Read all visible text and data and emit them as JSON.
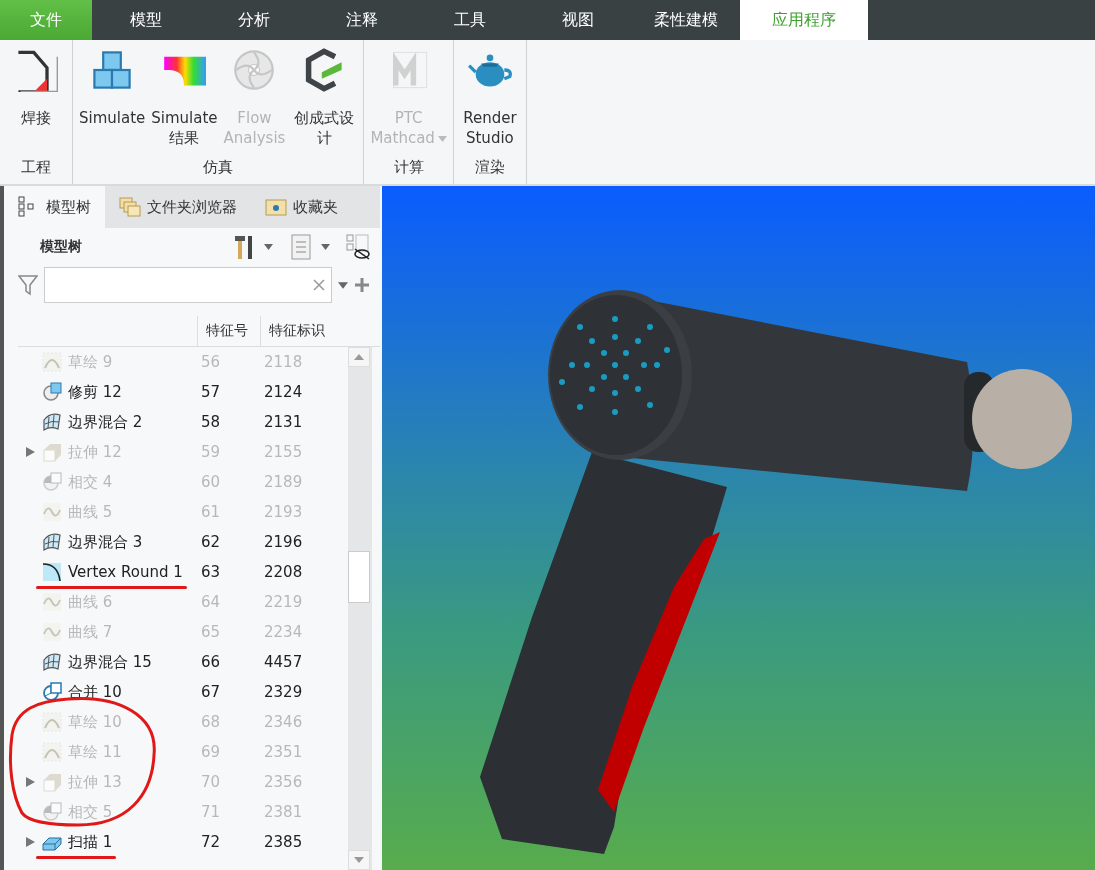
{
  "menu_tabs": [
    {
      "label": "文件",
      "kind": "file",
      "selected": false
    },
    {
      "label": "模型",
      "kind": "tab",
      "selected": false
    },
    {
      "label": "分析",
      "kind": "tab",
      "selected": false
    },
    {
      "label": "注释",
      "kind": "tab",
      "selected": false
    },
    {
      "label": "工具",
      "kind": "tab",
      "selected": false
    },
    {
      "label": "视图",
      "kind": "tab",
      "selected": false
    },
    {
      "label": "柔性建模",
      "kind": "tab",
      "selected": false
    },
    {
      "label": "应用程序",
      "kind": "tab",
      "selected": true
    }
  ],
  "ribbon": {
    "groups": [
      {
        "label": "工程",
        "buttons": [
          {
            "label": "焊接",
            "kind": "weld",
            "disabled": false,
            "dropdown": false
          }
        ]
      },
      {
        "label": "仿真",
        "buttons": [
          {
            "label": "Simulate",
            "kind": "simulate",
            "disabled": false,
            "dropdown": false
          },
          {
            "label": "Simulate\n结果",
            "kind": "results",
            "disabled": false,
            "dropdown": false
          },
          {
            "label": "Flow\nAnalysis",
            "kind": "flow",
            "disabled": true,
            "dropdown": false
          },
          {
            "label": "创成式设计",
            "kind": "generative",
            "disabled": false,
            "dropdown": false
          }
        ]
      },
      {
        "label": "计算",
        "buttons": [
          {
            "label": "PTC\nMathcad",
            "kind": "mathcad",
            "disabled": true,
            "dropdown": true
          }
        ]
      },
      {
        "label": "渲染",
        "buttons": [
          {
            "label": "Render\nStudio",
            "kind": "render",
            "disabled": false,
            "dropdown": false
          }
        ]
      }
    ]
  },
  "panel_tabs": [
    {
      "label": "模型树",
      "kind": "tree",
      "selected": true
    },
    {
      "label": "文件夹浏览器",
      "kind": "folders",
      "selected": false
    },
    {
      "label": "收藏夹",
      "kind": "favorites",
      "selected": false
    }
  ],
  "model_tree": {
    "title": "模型树",
    "columns": [
      "特征号",
      "特征标识"
    ],
    "sections": [
      {
        "circled": false,
        "rows": [
          {
            "name": "草绘 9",
            "number": "56",
            "id": "2118",
            "kind": "sketch",
            "suppressed": true,
            "expandable": false,
            "underlined": false
          },
          {
            "name": "修剪 12",
            "number": "57",
            "id": "2124",
            "kind": "trim",
            "suppressed": false,
            "expandable": false,
            "underlined": false
          },
          {
            "name": "边界混合 2",
            "number": "58",
            "id": "2131",
            "kind": "blend",
            "suppressed": false,
            "expandable": false,
            "underlined": false
          },
          {
            "name": "拉伸 12",
            "number": "59",
            "id": "2155",
            "kind": "extrude",
            "suppressed": true,
            "expandable": true,
            "underlined": false
          },
          {
            "name": "相交 4",
            "number": "60",
            "id": "2189",
            "kind": "intersect",
            "suppressed": true,
            "expandable": false,
            "underlined": false
          },
          {
            "name": "曲线 5",
            "number": "61",
            "id": "2193",
            "kind": "curve",
            "suppressed": true,
            "expandable": false,
            "underlined": false
          },
          {
            "name": "边界混合 3",
            "number": "62",
            "id": "2196",
            "kind": "blend",
            "suppressed": false,
            "expandable": false,
            "underlined": false
          },
          {
            "name": "Vertex Round 1",
            "number": "63",
            "id": "2208",
            "kind": "round",
            "suppressed": false,
            "expandable": false,
            "underlined": true
          },
          {
            "name": "曲线 6",
            "number": "64",
            "id": "2219",
            "kind": "curve",
            "suppressed": true,
            "expandable": false,
            "underlined": false
          },
          {
            "name": "曲线 7",
            "number": "65",
            "id": "2234",
            "kind": "curve",
            "suppressed": true,
            "expandable": false,
            "underlined": false
          },
          {
            "name": "边界混合 15",
            "number": "66",
            "id": "4457",
            "kind": "blend",
            "suppressed": false,
            "expandable": false,
            "underlined": false
          },
          {
            "name": "合并 10",
            "number": "67",
            "id": "2329",
            "kind": "merge",
            "suppressed": false,
            "expandable": false,
            "underlined": false
          }
        ]
      },
      {
        "circled": true,
        "rows": [
          {
            "name": "草绘 10",
            "number": "68",
            "id": "2346",
            "kind": "sketch",
            "suppressed": true,
            "expandable": false,
            "underlined": false
          },
          {
            "name": "草绘 11",
            "number": "69",
            "id": "2351",
            "kind": "sketch",
            "suppressed": true,
            "expandable": false,
            "underlined": false
          },
          {
            "name": "拉伸 13",
            "number": "70",
            "id": "2356",
            "kind": "extrude",
            "suppressed": true,
            "expandable": true,
            "underlined": false
          },
          {
            "name": "相交 5",
            "number": "71",
            "id": "2381",
            "kind": "intersect",
            "suppressed": true,
            "expandable": false,
            "underlined": false
          }
        ]
      },
      {
        "circled": false,
        "rows": [
          {
            "name": "扫描 1",
            "number": "72",
            "id": "2385",
            "kind": "sweep",
            "suppressed": false,
            "expandable": true,
            "underlined": true
          }
        ]
      }
    ]
  }
}
